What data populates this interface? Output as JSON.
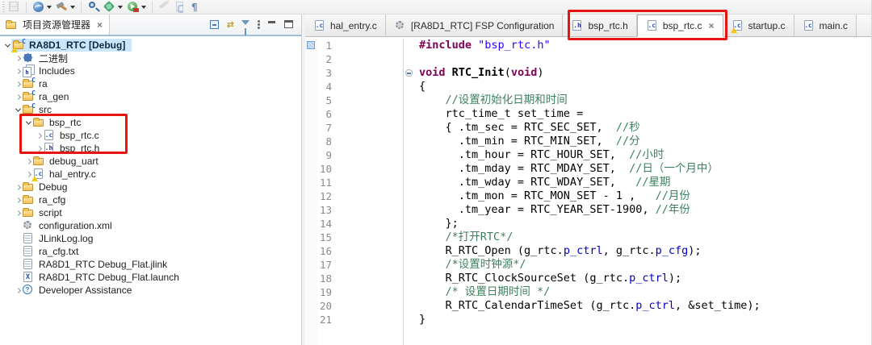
{
  "colors": {
    "highlight_red": "#e8150f",
    "selection_bg": "#cbe6f8",
    "keyword": "#7f0055",
    "string": "#2a00ff",
    "comment": "#3f7f5f",
    "field": "#0000c0"
  },
  "toolbar": {
    "icons": [
      "save",
      "generate-project-content",
      "build",
      "search",
      "debug",
      "run",
      "clean",
      "refresh-document",
      "show-whitespace"
    ],
    "pilcrow": "¶"
  },
  "explorer": {
    "title": "项目资源管理器",
    "close": "×",
    "tree": [
      {
        "label": "RA8D1_RTC [Debug]",
        "icon": "project",
        "level": 0,
        "chev": "open",
        "selected": true
      },
      {
        "label": "二进制",
        "icon": "binary",
        "level": 1,
        "chev": "closed"
      },
      {
        "label": "Includes",
        "icon": "includes",
        "level": 1,
        "chev": "closed"
      },
      {
        "label": "ra",
        "icon": "srcfolder",
        "level": 1,
        "chev": "closed"
      },
      {
        "label": "ra_gen",
        "icon": "srcfolder",
        "level": 1,
        "chev": "closed"
      },
      {
        "label": "src",
        "icon": "srcfolder",
        "level": 1,
        "chev": "open"
      },
      {
        "label": "bsp_rtc",
        "icon": "folder",
        "level": 2,
        "chev": "open"
      },
      {
        "label": "bsp_rtc.c",
        "icon": "file-c",
        "level": 3,
        "chev": "closed"
      },
      {
        "label": "bsp_rtc.h",
        "icon": "file-h",
        "level": 3,
        "chev": "closed"
      },
      {
        "label": "debug_uart",
        "icon": "folder",
        "level": 2,
        "chev": "closed"
      },
      {
        "label": "hal_entry.c",
        "icon": "file-c-warn",
        "level": 2,
        "chev": "closed"
      },
      {
        "label": "Debug",
        "icon": "folder",
        "level": 1,
        "chev": "closed"
      },
      {
        "label": "ra_cfg",
        "icon": "folder",
        "level": 1,
        "chev": "closed"
      },
      {
        "label": "script",
        "icon": "folder",
        "level": 1,
        "chev": "closed"
      },
      {
        "label": "configuration.xml",
        "icon": "gear",
        "level": 1,
        "chev": "none"
      },
      {
        "label": "JLinkLog.log",
        "icon": "textfile",
        "level": 1,
        "chev": "none"
      },
      {
        "label": "ra_cfg.txt",
        "icon": "textfile",
        "level": 1,
        "chev": "none"
      },
      {
        "label": "RA8D1_RTC Debug_Flat.jlink",
        "icon": "textfile",
        "level": 1,
        "chev": "none"
      },
      {
        "label": "RA8D1_RTC Debug_Flat.launch",
        "icon": "launch",
        "level": 1,
        "chev": "none"
      },
      {
        "label": "Developer Assistance",
        "icon": "help",
        "level": 1,
        "chev": "closed"
      }
    ]
  },
  "editor": {
    "tabs": [
      {
        "label": "hal_entry.c",
        "icon": "file-c"
      },
      {
        "label": "[RA8D1_RTC] FSP Configuration",
        "icon": "gear"
      },
      {
        "label": "bsp_rtc.h",
        "icon": "file-h"
      },
      {
        "label": "bsp_rtc.c",
        "icon": "file-c",
        "active": true,
        "close": "×"
      },
      {
        "label": "startup.c",
        "icon": "file-c-warn"
      },
      {
        "label": "main.c",
        "icon": "file-c"
      }
    ],
    "code": {
      "lines": [
        {
          "n": 1,
          "mark": true,
          "segments": [
            [
              "kw",
              "#include"
            ],
            [
              "pln",
              " "
            ],
            [
              "str",
              "\"bsp_rtc.h\""
            ]
          ]
        },
        {
          "n": 2,
          "segments": []
        },
        {
          "n": 3,
          "fold": true,
          "segments": [
            [
              "kw",
              "void"
            ],
            [
              "pln",
              " "
            ],
            [
              "fn",
              "RTC_Init"
            ],
            [
              "pln",
              "("
            ],
            [
              "kw",
              "void"
            ],
            [
              "pln",
              ")"
            ]
          ]
        },
        {
          "n": 4,
          "segments": [
            [
              "pln",
              "{"
            ]
          ]
        },
        {
          "n": 5,
          "segments": [
            [
              "pln",
              "    "
            ],
            [
              "com",
              "//设置初始化日期和时间"
            ]
          ]
        },
        {
          "n": 6,
          "segments": [
            [
              "pln",
              "    rtc_time_t set_time ="
            ]
          ]
        },
        {
          "n": 7,
          "segments": [
            [
              "pln",
              "    { .tm_sec = RTC_SEC_SET,  "
            ],
            [
              "com",
              "//秒"
            ]
          ]
        },
        {
          "n": 8,
          "segments": [
            [
              "pln",
              "      .tm_min = RTC_MIN_SET,  "
            ],
            [
              "com",
              "//分"
            ]
          ]
        },
        {
          "n": 9,
          "segments": [
            [
              "pln",
              "      .tm_hour = RTC_HOUR_SET,  "
            ],
            [
              "com",
              "//小时"
            ]
          ]
        },
        {
          "n": 10,
          "segments": [
            [
              "pln",
              "      .tm_mday = RTC_MDAY_SET,  "
            ],
            [
              "com",
              "//日（一个月中）"
            ]
          ]
        },
        {
          "n": 11,
          "segments": [
            [
              "pln",
              "      .tm_wday = RTC_WDAY_SET,   "
            ],
            [
              "com",
              "//星期"
            ]
          ]
        },
        {
          "n": 12,
          "segments": [
            [
              "pln",
              "      .tm_mon = RTC_MON_SET - 1 ,   "
            ],
            [
              "com",
              "//月份"
            ]
          ]
        },
        {
          "n": 13,
          "segments": [
            [
              "pln",
              "      .tm_year = RTC_YEAR_SET-1900, "
            ],
            [
              "com",
              "//年份"
            ]
          ]
        },
        {
          "n": 14,
          "segments": [
            [
              "pln",
              "    };"
            ]
          ]
        },
        {
          "n": 15,
          "segments": [
            [
              "pln",
              "    "
            ],
            [
              "com",
              "/*打开RTC*/"
            ]
          ]
        },
        {
          "n": 16,
          "segments": [
            [
              "pln",
              "    R_RTC_Open (g_rtc."
            ],
            [
              "fld",
              "p_ctrl"
            ],
            [
              "pln",
              ", g_rtc."
            ],
            [
              "fld",
              "p_cfg"
            ],
            [
              "pln",
              ");"
            ]
          ]
        },
        {
          "n": 17,
          "segments": [
            [
              "pln",
              "    "
            ],
            [
              "com",
              "/*设置时钟源*/"
            ]
          ]
        },
        {
          "n": 18,
          "segments": [
            [
              "pln",
              "    R_RTC_ClockSourceSet (g_rtc."
            ],
            [
              "fld",
              "p_ctrl"
            ],
            [
              "pln",
              ");"
            ]
          ]
        },
        {
          "n": 19,
          "segments": [
            [
              "pln",
              "    "
            ],
            [
              "com",
              "/* 设置日期时间 */"
            ]
          ]
        },
        {
          "n": 20,
          "segments": [
            [
              "pln",
              "    R_RTC_CalendarTimeSet (g_rtc."
            ],
            [
              "fld",
              "p_ctrl"
            ],
            [
              "pln",
              ", &set_time);"
            ]
          ]
        },
        {
          "n": 21,
          "segments": [
            [
              "pln",
              "}"
            ]
          ]
        }
      ]
    }
  },
  "icon_glyphs": {
    "c_badge": "C",
    "file_c": ".c",
    "file_h": ".h",
    "launch_x": "X",
    "include_h": "h",
    "help": "?",
    "link": "⇄"
  }
}
